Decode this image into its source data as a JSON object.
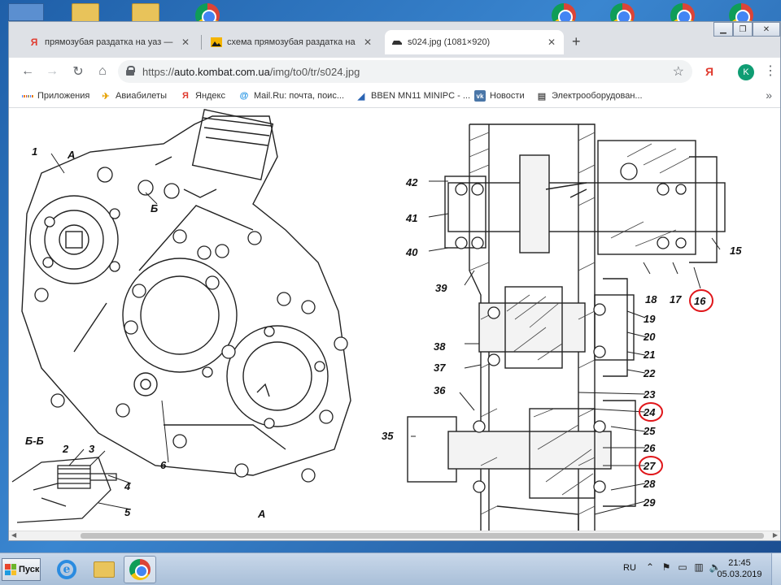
{
  "browser": {
    "tabs": [
      {
        "favicon": "Я",
        "favicon_color": "#e03b2f",
        "title": "прямозубая раздатка на уаз — Ян",
        "active": false
      },
      {
        "favicon": "image-icon",
        "title": "схема прямозубая раздатка на уаз",
        "active": false
      },
      {
        "favicon": "car-icon",
        "title": "s024.jpg (1081×920)",
        "active": true
      }
    ],
    "new_tab": "+",
    "url_scheme": "https://",
    "url_host": "auto.kombat.com.ua",
    "url_path": "/img/to0/tr/s024.jpg",
    "ext_yandex": "Я",
    "avatar_letter": "K"
  },
  "bookmarks": [
    {
      "icon": "apps-grid-icon",
      "label": "Приложения"
    },
    {
      "icon": "plane-icon",
      "label": "Авиабилеты"
    },
    {
      "icon": "Я",
      "label": "Яндекс"
    },
    {
      "icon": "mailru-icon",
      "label": "Mail.Ru: почта, поис..."
    },
    {
      "icon": "doc-icon",
      "label": "BBEN MN11 MINIPC - ..."
    },
    {
      "icon": "vk-icon",
      "label": "Новости"
    },
    {
      "icon": "doc-icon",
      "label": "Электрооборудован..."
    }
  ],
  "drawing": {
    "left_labels": [
      "1",
      "А",
      "Б",
      "6",
      "Б-Б",
      "2",
      "3",
      "4",
      "5",
      "А"
    ],
    "right_labels": [
      "42",
      "41",
      "40",
      "39",
      "38",
      "37",
      "36",
      "35",
      "15",
      "18",
      "17",
      "16",
      "19",
      "20",
      "21",
      "22",
      "23",
      "24",
      "25",
      "26",
      "27",
      "28",
      "29"
    ],
    "circled_labels": [
      "16",
      "24",
      "27"
    ]
  },
  "taskbar": {
    "start_label": "Пуск",
    "language": "RU",
    "time": "21:45",
    "date": "05.03.2019"
  },
  "colors": {
    "accent_circle": "#e0161a",
    "avatar": "#0f9d73"
  }
}
